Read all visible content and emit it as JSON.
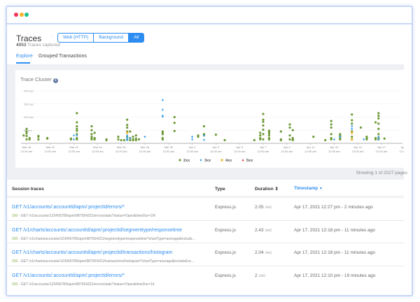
{
  "header": {
    "title": "Traces",
    "count": "4053",
    "count_label": "Traces captured",
    "separator": "·"
  },
  "filters": [
    {
      "label": "Web (HTTP)",
      "active": false
    },
    {
      "label": "Background",
      "active": false
    },
    {
      "label": "All",
      "active": true
    }
  ],
  "tabs": [
    {
      "label": "Explore",
      "active": true
    },
    {
      "label": "Grouped Transactions",
      "active": false
    }
  ],
  "chart_title": "Trace Cluster",
  "chart_data": {
    "type": "scatter",
    "title": "Trace Cluster",
    "yticks": [
      "200 sec",
      "150 sec",
      "100 sec",
      "50 sec"
    ],
    "ylim": [
      0,
      200
    ],
    "xlim": [
      "2021-03-17 12:00",
      "2021-04-19 12:00"
    ],
    "xticks": [
      [
        "Mar 18",
        "12:00 am"
      ],
      [
        "Mar 20",
        "12:00 am"
      ],
      [
        "Mar 22",
        "12:00 am"
      ],
      [
        "Mar 24",
        "12:00 am"
      ],
      [
        "Mar 26",
        "12:00 am"
      ],
      [
        "Mar 28",
        "12:00 am"
      ],
      [
        "Mar 30",
        "12:00 am"
      ],
      [
        "Apr 1",
        "12:00 am"
      ],
      [
        "Apr 3",
        "12:00 am"
      ],
      [
        "Apr 5",
        "12:00 am"
      ],
      [
        "Apr 7",
        "12:00 am"
      ],
      [
        "Apr 9",
        "12:00 am"
      ],
      [
        "Apr 11",
        "12:00 am"
      ],
      [
        "Apr 13",
        "12:00 am"
      ],
      [
        "Apr 15",
        "12:00 am"
      ],
      [
        "Apr 17",
        "12:00 am"
      ],
      [
        "Apr 19",
        "12:00 am"
      ]
    ],
    "xtick_dates": [
      "2021-03-18",
      "2021-03-20",
      "2021-03-22",
      "2021-03-24",
      "2021-03-26",
      "2021-03-28",
      "2021-03-30",
      "2021-04-01",
      "2021-04-03",
      "2021-04-05",
      "2021-04-07",
      "2021-04-09",
      "2021-04-11",
      "2021-04-13",
      "2021-04-15",
      "2021-04-17",
      "2021-04-19"
    ],
    "grid": true,
    "legend_placement": "bottom",
    "legend": [
      {
        "name": "2xx",
        "color": "#6f9a3a",
        "shape": "circle"
      },
      {
        "name": "3xx",
        "color": "#3aa0ec",
        "shape": "diamond"
      },
      {
        "name": "4xx",
        "color": "#f0b429",
        "shape": "square"
      },
      {
        "name": "5xx",
        "color": "#e53935",
        "shape": "triangle"
      }
    ],
    "points": [
      {
        "x": "2021-03-17 18:00",
        "status": "2xx",
        "y": [
          30
        ]
      },
      {
        "x": "2021-03-18 00:00",
        "status": "2xx",
        "y": [
          15,
          28,
          38,
          45,
          55
        ]
      },
      {
        "x": "2021-03-18 06:00",
        "status": "2xx",
        "y": [
          15,
          20
        ]
      },
      {
        "x": "2021-03-19 00:00",
        "status": "2xx",
        "y": [
          15,
          25,
          28
        ]
      },
      {
        "x": "2021-03-19 18:00",
        "status": "2xx",
        "y": [
          18,
          20
        ]
      },
      {
        "x": "2021-03-21 18:00",
        "status": "2xx",
        "y": [
          15,
          18
        ]
      },
      {
        "x": "2021-03-22 06:00",
        "status": "2xx",
        "y": [
          115,
          80,
          65,
          55,
          48,
          35,
          20,
          15
        ]
      },
      {
        "x": "2021-03-23 12:00",
        "status": "2xx",
        "y": [
          65,
          50,
          35,
          25,
          18,
          15
        ]
      },
      {
        "x": "2021-03-23 18:00",
        "status": "2xx",
        "y": [
          40,
          20,
          15
        ]
      },
      {
        "x": "2021-03-24 18:00",
        "status": "2xx",
        "y": [
          15,
          12
        ]
      },
      {
        "x": "2021-03-25 18:00",
        "status": "2xx",
        "y": [
          25,
          15
        ]
      },
      {
        "x": "2021-03-26 00:00",
        "status": "2xx",
        "y": [
          12
        ]
      },
      {
        "x": "2021-03-26 06:00",
        "status": "2xx",
        "y": [
          12
        ]
      },
      {
        "x": "2021-03-26 12:00",
        "status": "2xx",
        "y": [
          90,
          70,
          60,
          45,
          25,
          15
        ]
      },
      {
        "x": "2021-03-26 18:00",
        "status": "2xx",
        "y": [
          45,
          20,
          12
        ]
      },
      {
        "x": "2021-03-27 00:00",
        "status": "2xx",
        "y": [
          15,
          12,
          25
        ]
      },
      {
        "x": "2021-03-27 06:00",
        "status": "2xx",
        "y": [
          12,
          18,
          30
        ]
      },
      {
        "x": "2021-03-27 12:00",
        "status": "2xx",
        "y": [
          15
        ]
      },
      {
        "x": "2021-03-29 12:00",
        "status": "2xx",
        "y": [
          45,
          40,
          35,
          20,
          15
        ]
      },
      {
        "x": "2021-03-30 12:00",
        "status": "2xx",
        "y": [
          100,
          78,
          47
        ]
      },
      {
        "x": "2021-04-01 12:00",
        "status": "2xx",
        "y": [
          30,
          25
        ]
      },
      {
        "x": "2021-04-02 00:00",
        "status": "2xx",
        "y": [
          65,
          35,
          30
        ]
      },
      {
        "x": "2021-04-03 00:00",
        "status": "2xx",
        "y": [
          33
        ]
      },
      {
        "x": "2021-04-03 18:00",
        "status": "2xx",
        "y": [
          12
        ]
      },
      {
        "x": "2021-04-06 06:00",
        "status": "2xx",
        "y": [
          12
        ]
      },
      {
        "x": "2021-04-06 18:00",
        "status": "2xx",
        "y": [
          40,
          30,
          20,
          15
        ]
      },
      {
        "x": "2021-04-07 00:00",
        "status": "2xx",
        "y": [
          112,
          90,
          82,
          68,
          52,
          35,
          15
        ]
      },
      {
        "x": "2021-04-07 12:00",
        "status": "2xx",
        "y": [
          48,
          45,
          38,
          30,
          20,
          15
        ]
      },
      {
        "x": "2021-04-08 12:00",
        "status": "2xx",
        "y": [
          45,
          15,
          12
        ]
      },
      {
        "x": "2021-04-09 06:00",
        "status": "2xx",
        "y": [
          72,
          60,
          30,
          15
        ]
      },
      {
        "x": "2021-04-09 12:00",
        "status": "2xx",
        "y": [
          50,
          20,
          15,
          12
        ]
      },
      {
        "x": "2021-04-11 06:00",
        "status": "2xx",
        "y": [
          25
        ]
      },
      {
        "x": "2021-04-12 06:00",
        "status": "2xx",
        "y": [
          12
        ]
      },
      {
        "x": "2021-04-12 18:00",
        "status": "2xx",
        "y": [
          85,
          72,
          60,
          35,
          20,
          15
        ]
      },
      {
        "x": "2021-04-13 12:00",
        "status": "2xx",
        "y": [
          35,
          30,
          25,
          20,
          15
        ]
      },
      {
        "x": "2021-04-14 12:00",
        "status": "2xx",
        "y": [
          110,
          88,
          75,
          45,
          25,
          15
        ]
      },
      {
        "x": "2021-04-15 06:00",
        "status": "2xx",
        "y": [
          60
        ]
      },
      {
        "x": "2021-04-15 18:00",
        "status": "2xx",
        "y": [
          25,
          20,
          15
        ]
      },
      {
        "x": "2021-04-16 12:00",
        "status": "2xx",
        "y": [
          80,
          20,
          15
        ]
      },
      {
        "x": "2021-04-16 18:00",
        "status": "2xx",
        "y": [
          115,
          105,
          95,
          75,
          55,
          35,
          20,
          15
        ]
      },
      {
        "x": "2021-04-17 06:00",
        "status": "2xx",
        "y": [
          18
        ]
      },
      {
        "x": "2021-03-22 00:00",
        "status": "3xx",
        "y": [
          30,
          15
        ]
      },
      {
        "x": "2021-03-22 06:00",
        "status": "3xx",
        "y": [
          30
        ]
      },
      {
        "x": "2021-03-26 12:00",
        "status": "3xx",
        "y": [
          30,
          22,
          15,
          12
        ]
      },
      {
        "x": "2021-03-26 18:00",
        "status": "3xx",
        "y": [
          20
        ]
      },
      {
        "x": "2021-03-28 00:00",
        "status": "3xx",
        "y": [
          25
        ]
      },
      {
        "x": "2021-03-29 12:00",
        "status": "3xx",
        "y": [
          165,
          128,
          105,
          102
        ]
      },
      {
        "x": "2021-04-01 00:00",
        "status": "3xx",
        "y": [
          25,
          15
        ]
      },
      {
        "x": "2021-04-02 00:00",
        "status": "3xx",
        "y": [
          30,
          13
        ]
      },
      {
        "x": "2021-04-13 00:00",
        "status": "3xx",
        "y": [
          15
        ]
      },
      {
        "x": "2021-04-13 12:00",
        "status": "3xx",
        "y": [
          25
        ]
      },
      {
        "x": "2021-04-14 12:00",
        "status": "3xx",
        "y": [
          65,
          55
        ]
      },
      {
        "x": "2021-04-15 12:00",
        "status": "3xx",
        "y": [
          15
        ]
      },
      {
        "x": "2021-04-16 18:00",
        "status": "3xx",
        "y": [
          15,
          25
        ]
      },
      {
        "x": "2021-03-26 12:00",
        "status": "4xx",
        "y": [
          40
        ]
      },
      {
        "x": "2021-04-14 12:00",
        "status": "4xx",
        "y": [
          40,
          15
        ]
      }
    ]
  },
  "pagination": "Showing 1 of 2027 pages",
  "table": {
    "columns": [
      {
        "label": "Session traces"
      },
      {
        "label": "Type"
      },
      {
        "label": "Duration",
        "sort_icon": "⇕"
      },
      {
        "label": "Timestamp",
        "sort_icon": "▼",
        "active": true
      }
    ],
    "rows": [
      {
        "title": "GET /v1/accounts/:accountId/apm/:projectId/errors/*",
        "status": "200",
        "detail": " - GET /v1/accounts/123456789/apm/987654321/errors/stats?status=Open&timeDur=1M",
        "type": "Express.js",
        "duration": "2.05",
        "unit": "sec",
        "timestamp": "Apr 17, 2021 12:27 pm - 2 minutes ago"
      },
      {
        "title": "GET /v1/charts/accounts/:accountId/apm/:projectId/segmenttype/responsetime",
        "status": "200",
        "detail": " - GET /v1/charts/accounts/123456789/apm/987654321/segmenttype/responsetime?chartType=average&include…",
        "type": "Express.js",
        "duration": "2.43",
        "unit": "sec",
        "timestamp": "Apr 17, 2021 12:18 pm - 11 minutes ago"
      },
      {
        "title": "GET /v1/charts/accounts/:accountId/apm/:projectId/transactions/histogram",
        "status": "200",
        "detail": " - GET /v1/charts/accounts/123456789/apm/987654321/transactions/histogram?chartType=average&includeExc…",
        "type": "Express.js",
        "duration": "2.04",
        "unit": "sec",
        "timestamp": "Apr 17, 2021 12:18 pm - 11 minutes ago"
      },
      {
        "title": "GET /v1/accounts/:accountId/apm/:projectId/errors/*",
        "status": "200",
        "detail": " - GET /v1/accounts/123456789/apm/987654321/errors/stats?status=Open&timeDur=1d",
        "type": "Express.js",
        "duration": "2",
        "unit": "sec",
        "timestamp": "Apr 17, 2021 12:10 pm - 19 minutes ago"
      }
    ]
  },
  "window_dots": [
    "#f4365c",
    "#f9b52a",
    "#1fc48d"
  ]
}
